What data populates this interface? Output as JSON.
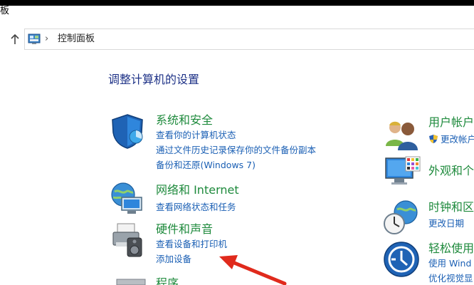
{
  "window": {
    "title_fragment": "板"
  },
  "address": {
    "location": "控制面板"
  },
  "main": {
    "heading": "调整计算机的设置",
    "left_categories": [
      {
        "title": "系统和安全",
        "links": [
          "查看你的计算机状态",
          "通过文件历史记录保存你的文件备份副本",
          "备份和还原(Windows 7)"
        ]
      },
      {
        "title": "网络和 Internet",
        "links": [
          "查看网络状态和任务"
        ]
      },
      {
        "title": "硬件和声音",
        "links": [
          "查看设备和打印机",
          "添加设备"
        ]
      },
      {
        "title": "程序",
        "links": []
      }
    ],
    "right_categories": [
      {
        "title": "用户帐户",
        "links": [
          "更改帐户"
        ]
      },
      {
        "title": "外观和个",
        "links": []
      },
      {
        "title": "时钟和区",
        "links": [
          "更改日期"
        ]
      },
      {
        "title": "轻松使用",
        "links": [
          "使用 Wind",
          "优化视觉显"
        ]
      }
    ]
  },
  "colors": {
    "category_title": "#1e8a3c",
    "link": "#1a5fb4",
    "heading": "#1e3287",
    "annotation_arrow": "#e02a1c"
  }
}
